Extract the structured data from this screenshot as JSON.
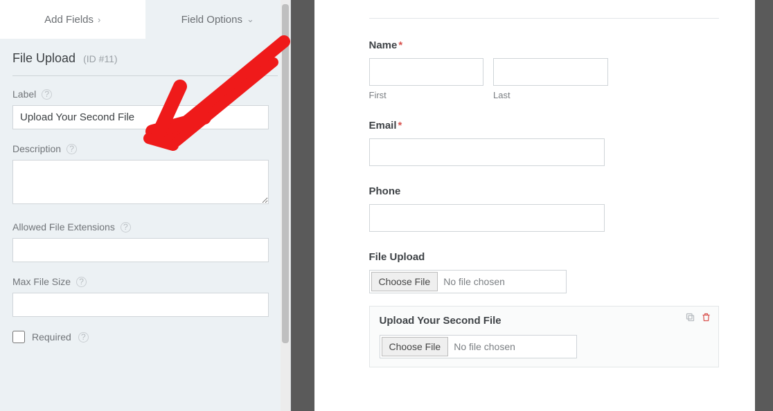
{
  "tabs": {
    "add_fields": "Add Fields",
    "field_options": "Field Options"
  },
  "section": {
    "title": "File Upload",
    "id_label": "(ID #11)"
  },
  "options": {
    "label_label": "Label",
    "label_value": "Upload Your Second File",
    "description_label": "Description",
    "description_value": "",
    "allowed_ext_label": "Allowed File Extensions",
    "allowed_ext_value": "",
    "max_size_label": "Max File Size",
    "max_size_value": "",
    "required_label": "Required"
  },
  "preview": {
    "name_label": "Name",
    "first_sub": "First",
    "last_sub": "Last",
    "email_label": "Email",
    "phone_label": "Phone",
    "file1_label": "File Upload",
    "choose_file": "Choose File",
    "no_file": "No file chosen",
    "file2_label": "Upload Your Second File"
  }
}
